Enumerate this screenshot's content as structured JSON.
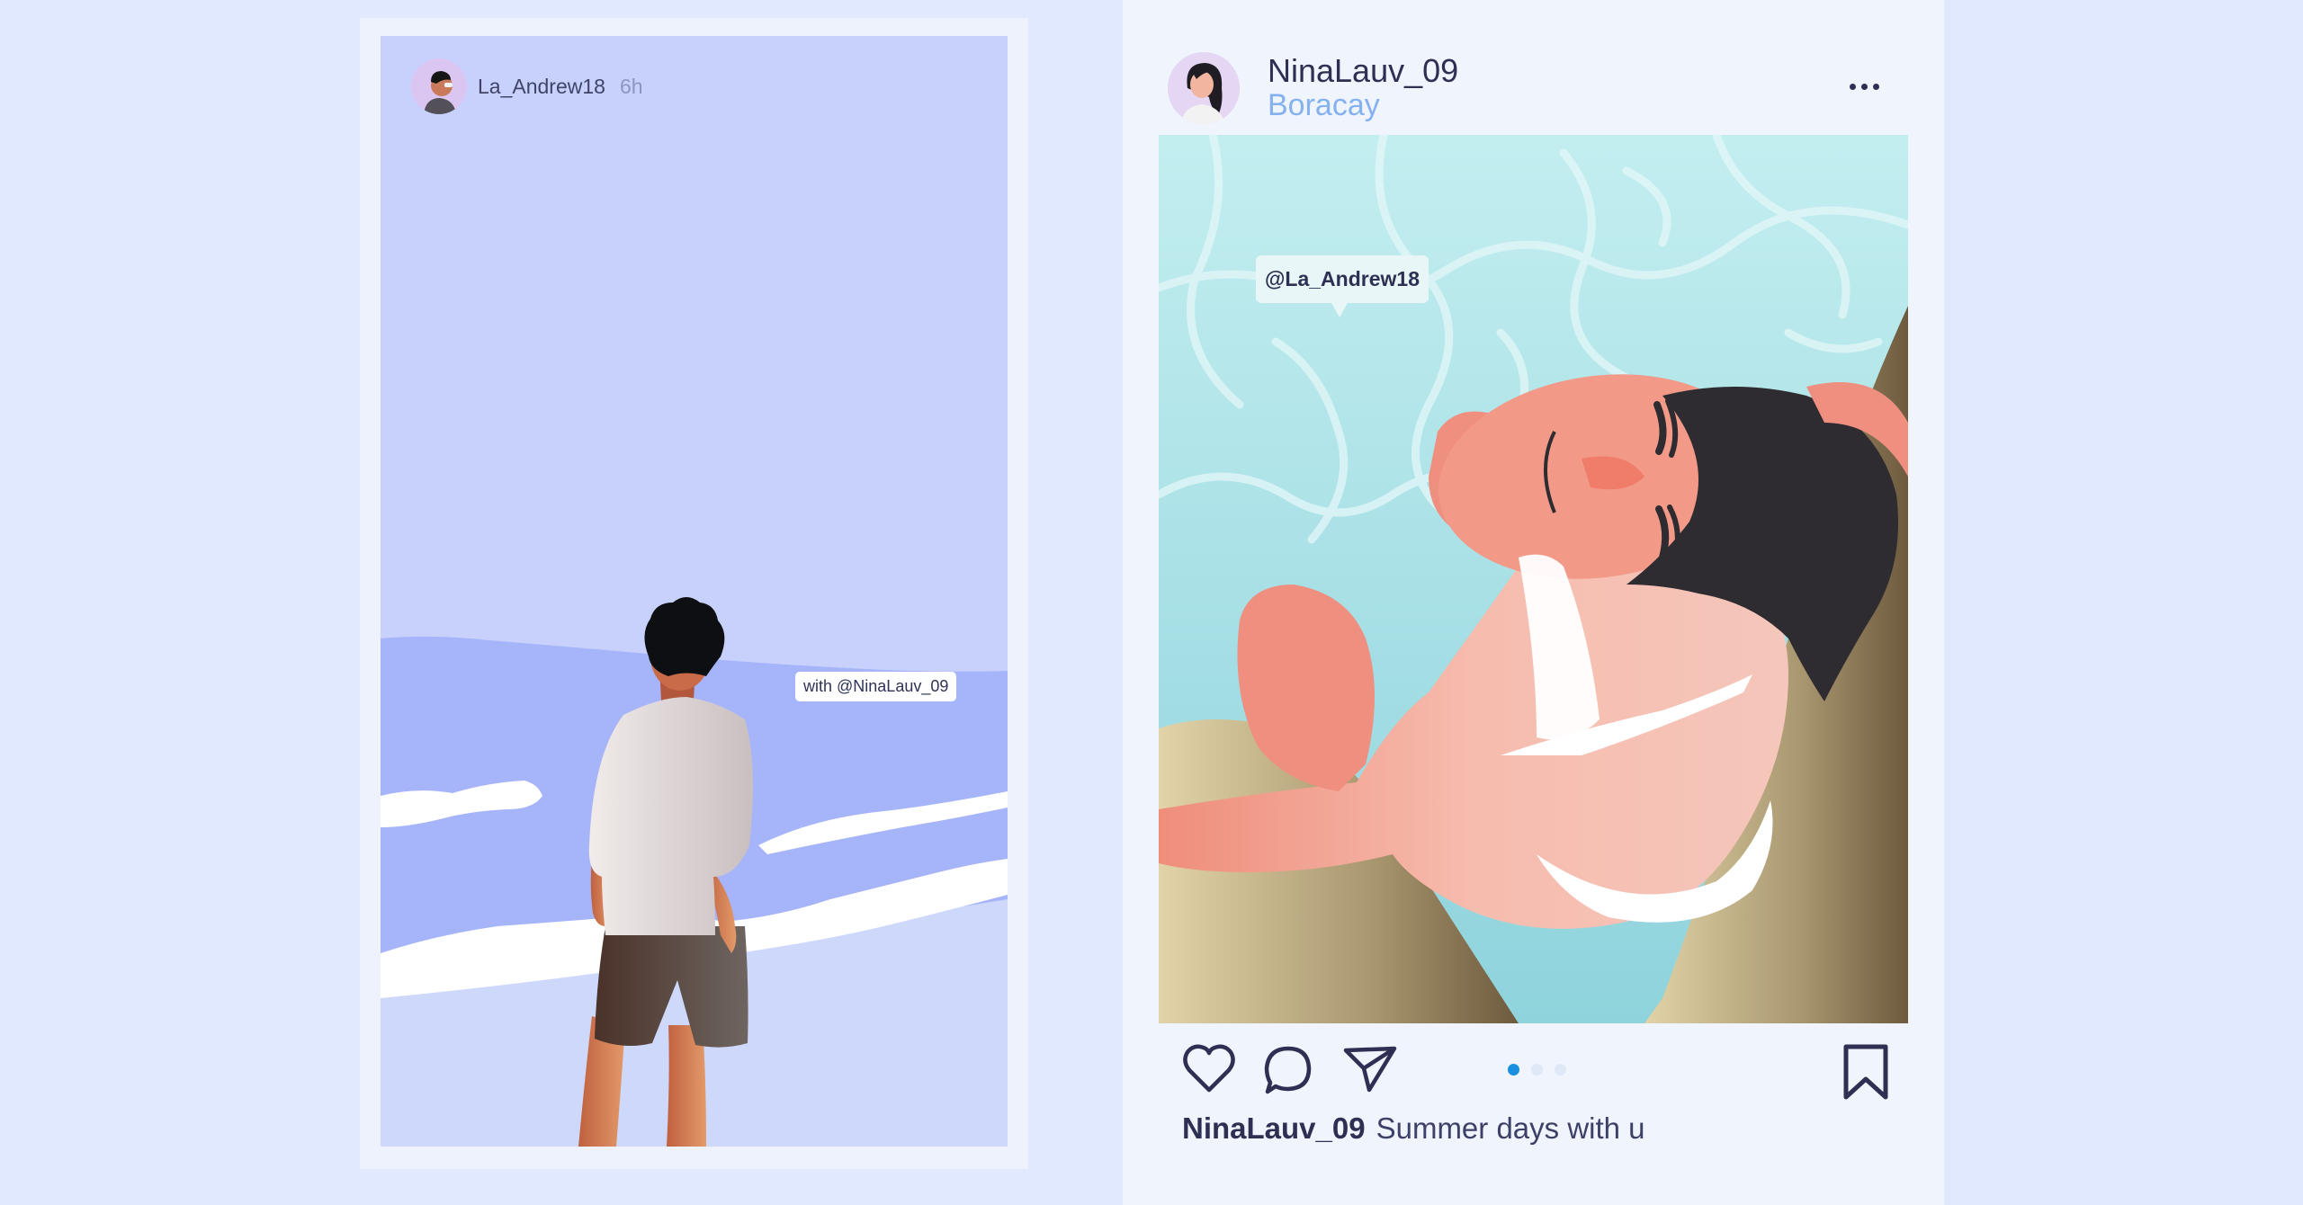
{
  "story": {
    "username": "La_Andrew18",
    "time": "6h",
    "tag": "with @NinaLauv_09"
  },
  "post": {
    "username": "NinaLauv_09",
    "location": "Boracay",
    "image_tag": "@La_Andrew18",
    "caption_user": "NinaLauv_09",
    "caption_text": "Summer days with u",
    "carousel": {
      "count": 3,
      "active": 1
    }
  },
  "icons": {
    "like": "heart-icon",
    "comment": "comment-bubble-icon",
    "share": "paper-plane-icon",
    "save": "bookmark-icon",
    "more": "more-horizontal-icon"
  },
  "colors": {
    "background": "#e0e9fd",
    "accent": "#85b2ef",
    "dot_active": "#1a8fe0",
    "text_dark": "#2d3053"
  }
}
